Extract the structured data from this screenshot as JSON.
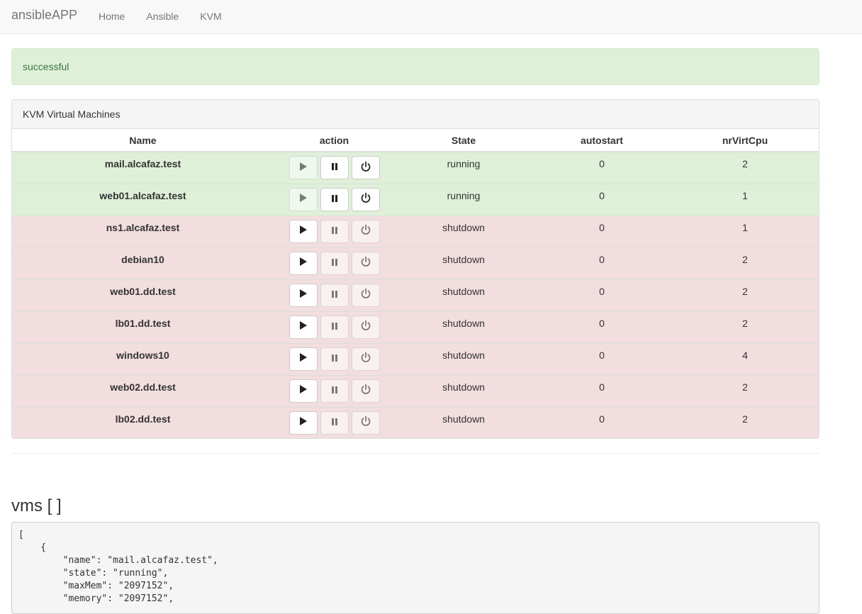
{
  "navbar": {
    "brand": "ansibleAPP",
    "links": [
      "Home",
      "Ansible",
      "KVM"
    ]
  },
  "alert": {
    "text": "successful"
  },
  "panel": {
    "title": "KVM Virtual Machines",
    "columns": [
      "Name",
      "action",
      "State",
      "autostart",
      "nrVirtCpu"
    ],
    "rows": [
      {
        "name": "mail.alcafaz.test",
        "state": "running",
        "autostart": "0",
        "nrVirtCpu": "2",
        "status": "success"
      },
      {
        "name": "web01.alcafaz.test",
        "state": "running",
        "autostart": "0",
        "nrVirtCpu": "1",
        "status": "success"
      },
      {
        "name": "ns1.alcafaz.test",
        "state": "shutdown",
        "autostart": "0",
        "nrVirtCpu": "1",
        "status": "danger"
      },
      {
        "name": "debian10",
        "state": "shutdown",
        "autostart": "0",
        "nrVirtCpu": "2",
        "status": "danger"
      },
      {
        "name": "web01.dd.test",
        "state": "shutdown",
        "autostart": "0",
        "nrVirtCpu": "2",
        "status": "danger"
      },
      {
        "name": "lb01.dd.test",
        "state": "shutdown",
        "autostart": "0",
        "nrVirtCpu": "2",
        "status": "danger"
      },
      {
        "name": "windows10",
        "state": "shutdown",
        "autostart": "0",
        "nrVirtCpu": "4",
        "status": "danger"
      },
      {
        "name": "web02.dd.test",
        "state": "shutdown",
        "autostart": "0",
        "nrVirtCpu": "2",
        "status": "danger"
      },
      {
        "name": "lb02.dd.test",
        "state": "shutdown",
        "autostart": "0",
        "nrVirtCpu": "2",
        "status": "danger"
      }
    ]
  },
  "vms_section": {
    "title": "vms [ ]",
    "json_text": "[\n    {\n        \"name\": \"mail.alcafaz.test\",\n        \"state\": \"running\",\n        \"maxMem\": \"2097152\",\n        \"memory\": \"2097152\","
  },
  "icons": {
    "play": "play-icon",
    "pause": "pause-icon",
    "power": "power-icon"
  },
  "colors": {
    "success_row": "#dff0d8",
    "danger_row": "#f2dede",
    "alert_text": "#3c763d"
  }
}
